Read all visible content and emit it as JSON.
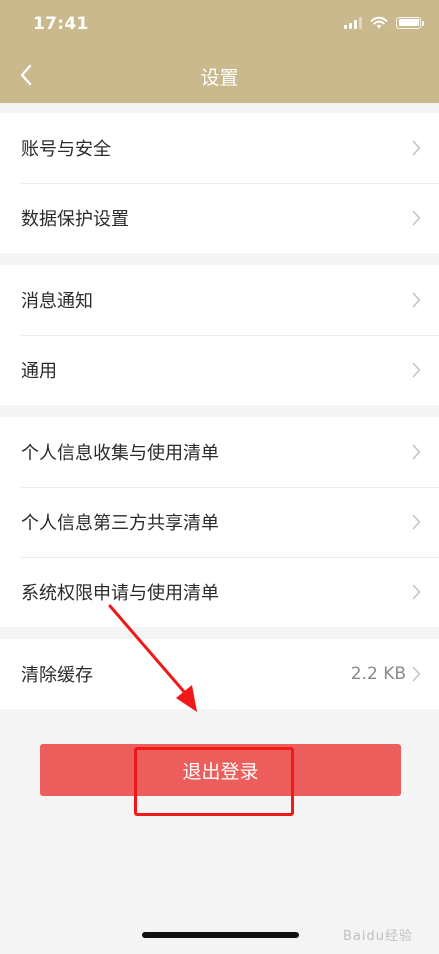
{
  "status_bar": {
    "time": "17:41"
  },
  "nav": {
    "title": "设置"
  },
  "groups": [
    {
      "rows": [
        {
          "label": "账号与安全"
        },
        {
          "label": "数据保护设置"
        }
      ]
    },
    {
      "rows": [
        {
          "label": "消息通知"
        },
        {
          "label": "通用"
        }
      ]
    },
    {
      "rows": [
        {
          "label": "个人信息收集与使用清单"
        },
        {
          "label": "个人信息第三方共享清单"
        },
        {
          "label": "系统权限申请与使用清单"
        }
      ]
    },
    {
      "rows": [
        {
          "label": "清除缓存",
          "value": "2.2 KB"
        }
      ]
    }
  ],
  "logout": {
    "label": "退出登录"
  },
  "watermark": {
    "text": "Baidu经验"
  },
  "colors": {
    "header": "#c9b98c",
    "logout": "#ec5e5b",
    "annotation": "#f01818"
  },
  "icons": [
    "back-arrow-icon",
    "chevron-right-icon",
    "signal-icon",
    "wifi-icon",
    "battery-icon"
  ]
}
